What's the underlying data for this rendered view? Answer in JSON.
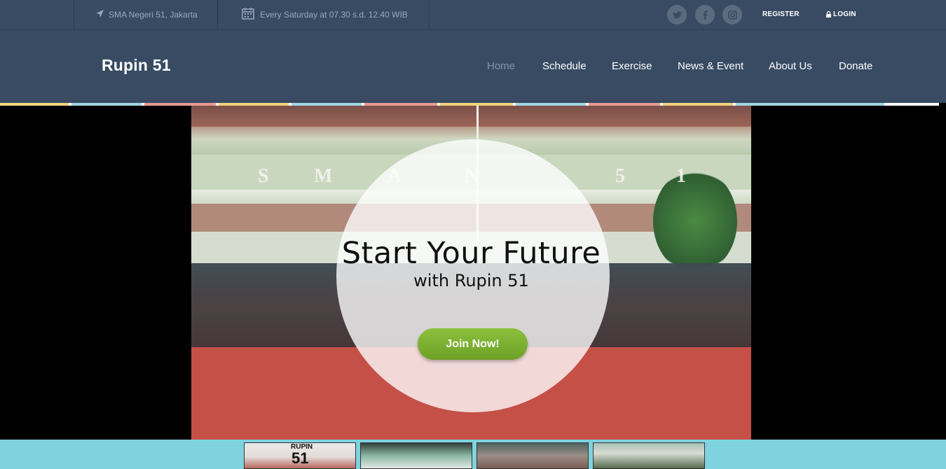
{
  "topbar": {
    "location": "SMA Negeri 51, Jakarta",
    "location_icon": "navigation-arrow-icon",
    "schedule": "Every Saturday at 07.30 s.d. 12.40 WIB",
    "schedule_icon": "calendar-icon",
    "social": [
      "twitter-icon",
      "facebook-icon",
      "instagram-icon"
    ],
    "register_label": "REGISTER",
    "login_label": "LOGIN"
  },
  "navbar": {
    "brand": "Rupin 51",
    "items": [
      {
        "label": "Home",
        "active": true
      },
      {
        "label": "Schedule",
        "active": false
      },
      {
        "label": "Exercise",
        "active": false
      },
      {
        "label": "News & Event",
        "active": false
      },
      {
        "label": "About Us",
        "active": false
      },
      {
        "label": "Donate",
        "active": false
      }
    ]
  },
  "stripe_colors": [
    "#f2d27a",
    "#9fd6e2",
    "#e89a93"
  ],
  "hero": {
    "wall_letters": [
      "S",
      "M",
      "A",
      "N",
      "5",
      "1"
    ],
    "title": "Start Your Future",
    "subtitle": "with Rupin 51",
    "cta_label": "Join Now!"
  },
  "thumbnails": {
    "first_label": "RUPIN",
    "first_number": "51"
  },
  "colors": {
    "header_bg": "#384b63",
    "cta_green": "#7bb12f",
    "strip_bg": "#7fd3df"
  }
}
